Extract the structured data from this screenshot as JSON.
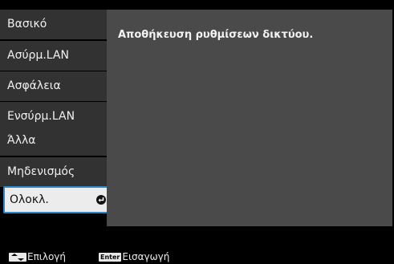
{
  "menu": {
    "items": [
      {
        "label": "Βασικό"
      },
      {
        "label": "Ασύρμ.LAN"
      },
      {
        "label": "Ασφάλεια"
      },
      {
        "label": "Ενσύρμ.LAN"
      },
      {
        "label": "Άλλα"
      },
      {
        "label": "Μηδενισμός"
      },
      {
        "label": "Ολοκλ.",
        "selected": true
      }
    ]
  },
  "content": {
    "message": "Αποθήκευση ρυθμίσεων δικτύου."
  },
  "footer": {
    "select_icon": "up-down-arrow-keys-icon",
    "select_label": "Επιλογή",
    "enter_key": "Enter",
    "enter_label": "Εισαγωγή"
  },
  "colors": {
    "menu_bg": "#323232",
    "selected_bg": "#ececec",
    "selected_border": "#2f86c7",
    "panel_bg": "#4a4a4a",
    "screen_bg": "#000000"
  }
}
